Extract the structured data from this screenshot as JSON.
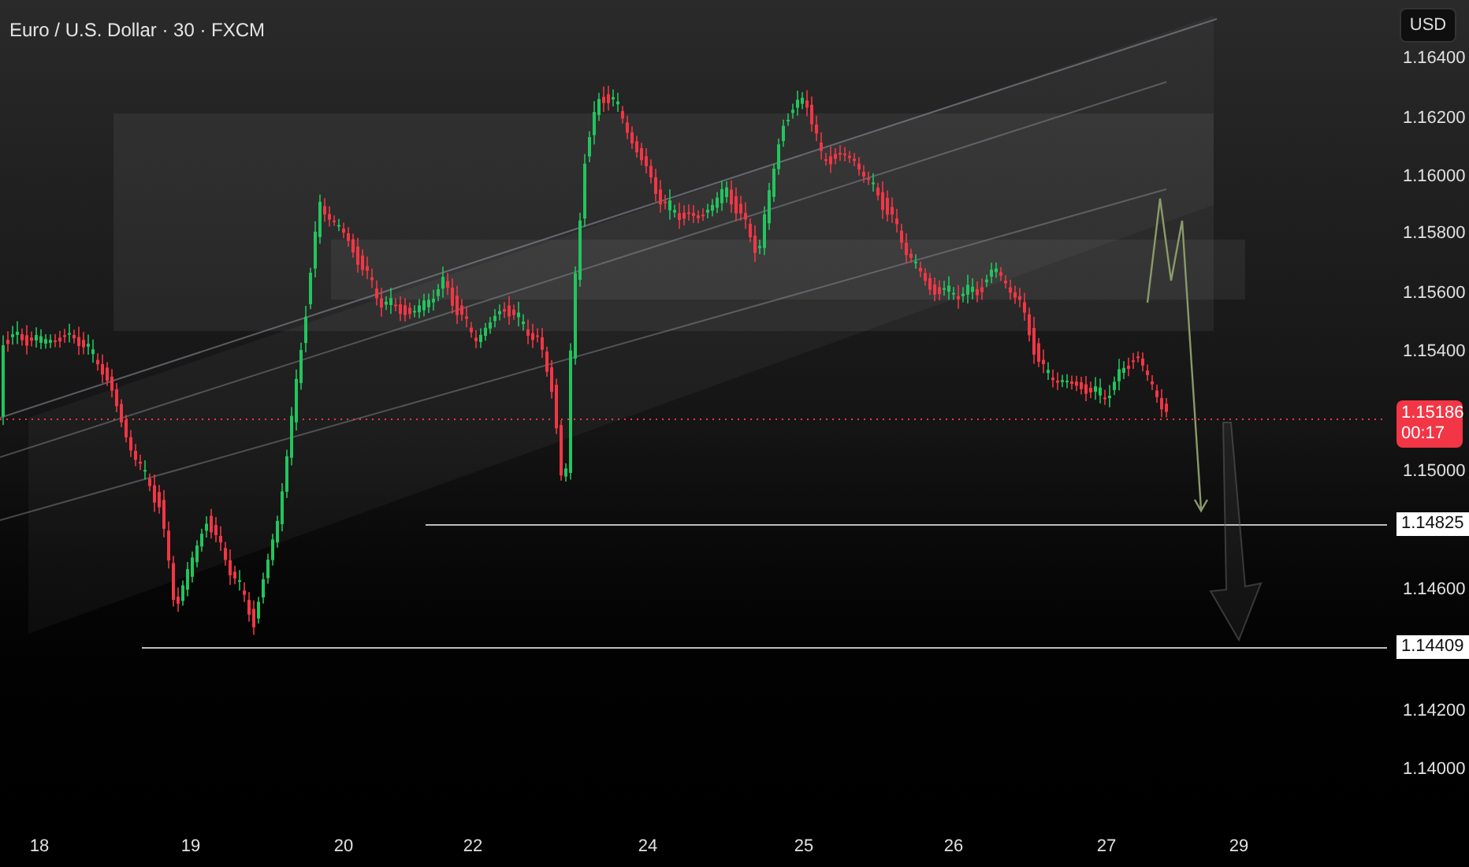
{
  "header": {
    "title": "Euro / U.S. Dollar · 30 · FXCM"
  },
  "currency_button": {
    "label": "USD"
  },
  "price_axis": [
    {
      "kind": "tick",
      "label": "1.16400"
    },
    {
      "kind": "tick",
      "label": "1.16200"
    },
    {
      "kind": "tick",
      "label": "1.16000"
    },
    {
      "kind": "tick",
      "label": "1.15800"
    },
    {
      "kind": "tick",
      "label": "1.15600"
    },
    {
      "kind": "tick",
      "label": "1.15400"
    },
    {
      "kind": "current",
      "label": "1.15186",
      "countdown": "00:17"
    },
    {
      "kind": "tick",
      "label": "1.15000"
    },
    {
      "kind": "marker",
      "label": "1.14825"
    },
    {
      "kind": "tick",
      "label": "1.14600"
    },
    {
      "kind": "marker",
      "label": "1.14409"
    },
    {
      "kind": "tick",
      "label": "1.14200"
    },
    {
      "kind": "tick",
      "label": "1.14000"
    }
  ],
  "time_axis": [
    "18",
    "19",
    "20",
    "22",
    "24",
    "25",
    "26",
    "27",
    "29"
  ]
}
